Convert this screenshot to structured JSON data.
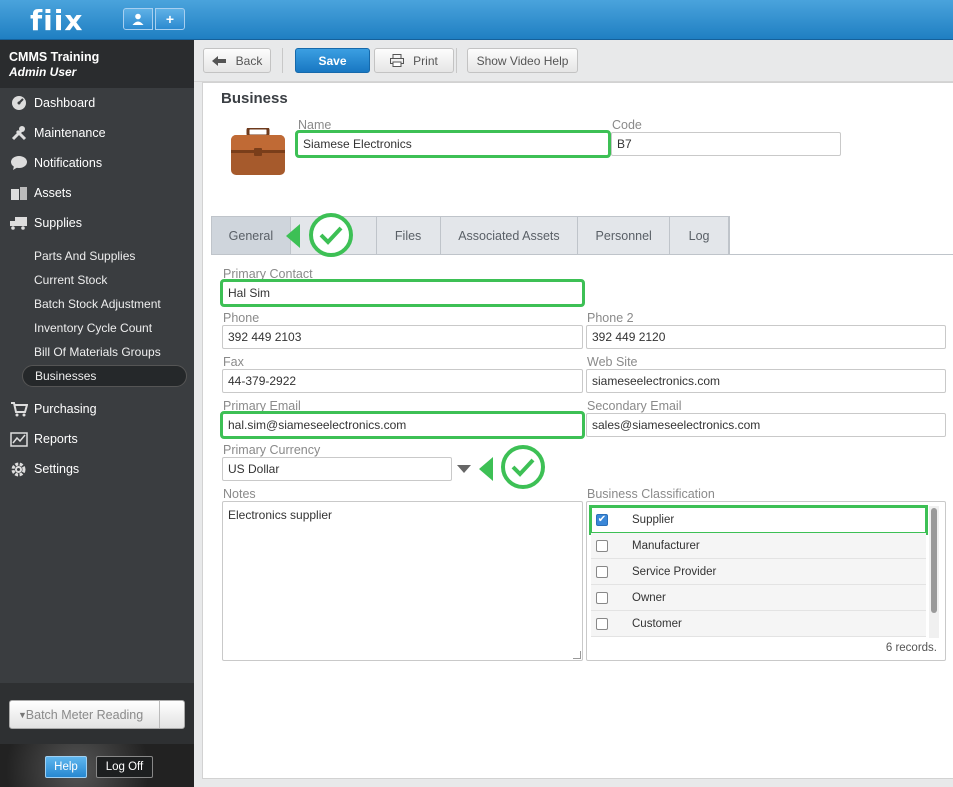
{
  "app": {
    "logo": "fiix",
    "user_icon": "user-icon",
    "add_icon": "plus-icon"
  },
  "sidebar": {
    "org_name": "CMMS Training",
    "org_role": "Admin User",
    "nav": [
      {
        "label": "Dashboard",
        "icon": "dashboard-icon"
      },
      {
        "label": "Maintenance",
        "icon": "tools-icon"
      },
      {
        "label": "Notifications",
        "icon": "chat-bubble-icon"
      },
      {
        "label": "Assets",
        "icon": "boxes-icon"
      },
      {
        "label": "Supplies",
        "icon": "truck-icon"
      },
      {
        "label": "Purchasing",
        "icon": "cart-icon"
      },
      {
        "label": "Reports",
        "icon": "chart-icon"
      },
      {
        "label": "Settings",
        "icon": "gear-icon"
      }
    ],
    "supplies_sub": [
      "Parts And Supplies",
      "Current Stock",
      "Batch Stock Adjustment",
      "Inventory Cycle Count",
      "Bill Of Materials Groups",
      "Businesses"
    ],
    "active_sub": "Businesses",
    "batch_meter": "Batch Meter Reading",
    "help": "Help",
    "logoff": "Log Off"
  },
  "toolbar": {
    "back": "Back",
    "save": "Save",
    "print": "Print",
    "video_help": "Show Video Help"
  },
  "form": {
    "title": "Business",
    "name_label": "Name",
    "name_value": "Siamese Electronics",
    "code_label": "Code",
    "code_value": "B7",
    "tabs": [
      "General",
      "Files",
      "Associated Assets",
      "Personnel",
      "Log"
    ],
    "active_tab": "General",
    "primary_contact_label": "Primary Contact",
    "primary_contact_value": "Hal Sim",
    "phone_label": "Phone",
    "phone_value": "392 449 2103",
    "phone2_label": "Phone 2",
    "phone2_value": "392 449 2120",
    "fax_label": "Fax",
    "fax_value": "44-379-2922",
    "website_label": "Web Site",
    "website_value": "siameseelectronics.com",
    "primary_email_label": "Primary Email",
    "primary_email_value": "hal.sim@siameseelectronics.com",
    "secondary_email_label": "Secondary Email",
    "secondary_email_value": "sales@siameseelectronics.com",
    "currency_label": "Primary Currency",
    "currency_value": "US Dollar",
    "notes_label": "Notes",
    "notes_value": "Electronics supplier",
    "classification_label": "Business Classification",
    "classifications": [
      {
        "label": "Supplier",
        "checked": true
      },
      {
        "label": "Manufacturer",
        "checked": false
      },
      {
        "label": "Service Provider",
        "checked": false
      },
      {
        "label": "Owner",
        "checked": false
      },
      {
        "label": "Customer",
        "checked": false
      }
    ],
    "records": "6 records."
  },
  "colors": {
    "accent": "#1f7fc2",
    "highlight": "#3dc055",
    "sidebar": "#3a3d40"
  }
}
